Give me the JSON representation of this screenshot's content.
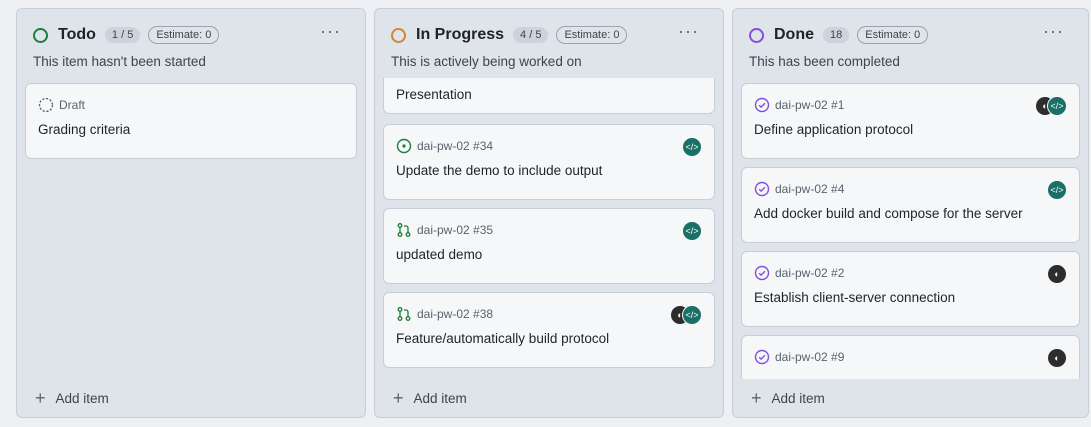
{
  "columns": [
    {
      "title": "Todo",
      "count": "1 / 5",
      "estimate": "Estimate: 0",
      "description": "This item hasn't been started",
      "status_color": "#1a7f37",
      "add_label": "Add item",
      "cards": [
        {
          "ref": "Draft",
          "title": "Grading criteria",
          "status_icon": "draft-icon"
        }
      ]
    },
    {
      "title": "In Progress",
      "count": "4 / 5",
      "estimate": "Estimate: 0",
      "description": "This is actively being worked on",
      "status_color": "#d4862e",
      "add_label": "Add item",
      "cards": [
        {
          "ref": "",
          "title": "Presentation",
          "status_icon": ""
        },
        {
          "ref": "dai-pw-02 #34",
          "title": "Update the demo to include output",
          "status_icon": "open-issue-icon"
        },
        {
          "ref": "dai-pw-02 #35",
          "title": "updated demo",
          "status_icon": "pull-request-icon"
        },
        {
          "ref": "dai-pw-02 #38",
          "title": "Feature/automatically build protocol",
          "status_icon": "pull-request-icon"
        }
      ]
    },
    {
      "title": "Done",
      "count": "18",
      "estimate": "Estimate: 0",
      "description": "This has been completed",
      "status_color": "#8250df",
      "add_label": "Add item",
      "cards": [
        {
          "ref": "dai-pw-02 #1",
          "title": "Define application protocol",
          "status_icon": "closed-issue-icon"
        },
        {
          "ref": "dai-pw-02 #4",
          "title": "Add docker build and compose for the server",
          "status_icon": "closed-issue-icon"
        },
        {
          "ref": "dai-pw-02 #2",
          "title": "Establish client-server connection",
          "status_icon": "closed-issue-icon"
        },
        {
          "ref": "dai-pw-02 #9",
          "title": "",
          "status_icon": "closed-issue-icon"
        }
      ]
    }
  ]
}
